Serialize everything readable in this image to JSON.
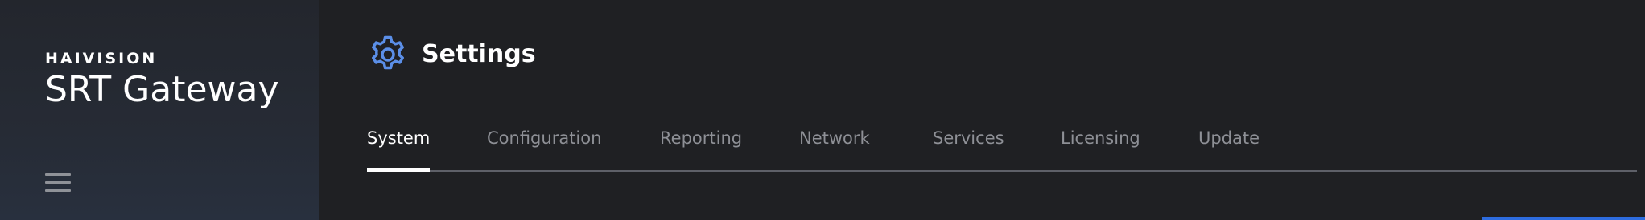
{
  "sidebar": {
    "brand_company": "HAIVISION",
    "brand_product": "SRT Gateway",
    "menu_icon": "hamburger-menu-icon"
  },
  "header": {
    "icon": "gear-icon",
    "title": "Settings",
    "accent_color": "#5b8fe8"
  },
  "tabs": [
    {
      "label": "System",
      "active": true
    },
    {
      "label": "Configuration",
      "active": false
    },
    {
      "label": "Reporting",
      "active": false
    },
    {
      "label": "Network",
      "active": false
    },
    {
      "label": "Services",
      "active": false
    },
    {
      "label": "Licensing",
      "active": false
    },
    {
      "label": "Update",
      "active": false
    }
  ],
  "colors": {
    "background": "#1f2023",
    "tab_inactive": "#8e9096",
    "tab_active": "#ffffff",
    "accent_blue": "#2d6cdf"
  }
}
